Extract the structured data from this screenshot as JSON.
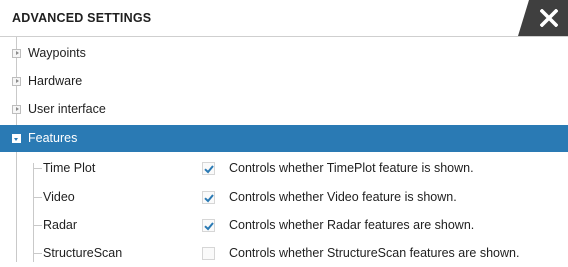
{
  "window": {
    "title": "ADVANCED SETTINGS",
    "close_icon": "close-icon"
  },
  "tree": {
    "nodes": [
      {
        "label": "Waypoints",
        "expanded": false,
        "selected": false
      },
      {
        "label": "Hardware",
        "expanded": false,
        "selected": false
      },
      {
        "label": "User interface",
        "expanded": false,
        "selected": false
      },
      {
        "label": "Features",
        "expanded": true,
        "selected": true
      }
    ],
    "features": [
      {
        "label": "Time Plot",
        "checked": true,
        "description": "Controls whether TimePlot feature is shown."
      },
      {
        "label": "Video",
        "checked": true,
        "description": "Controls whether Video feature is shown."
      },
      {
        "label": "Radar",
        "checked": true,
        "description": "Controls whether Radar features are shown."
      },
      {
        "label": "StructureScan",
        "checked": false,
        "description": "Controls whether StructureScan features are shown."
      }
    ]
  },
  "colors": {
    "selection": "#2a7ab4",
    "checkmark": "#2a7ab4",
    "close_button": "#3f3f3f"
  }
}
